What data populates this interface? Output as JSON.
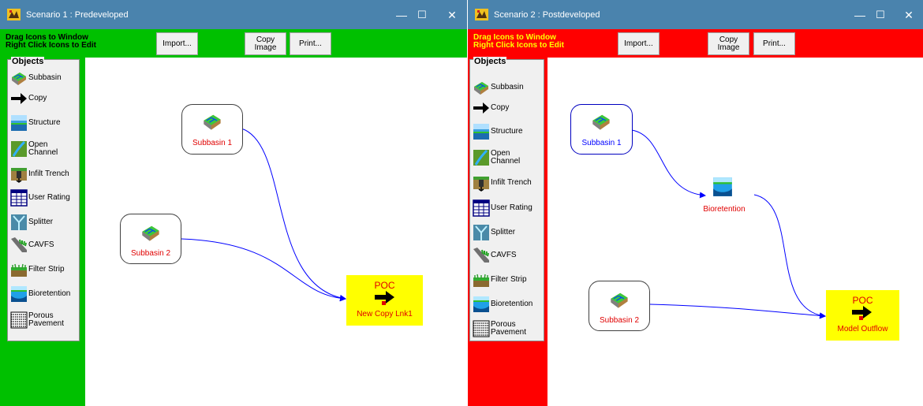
{
  "colors": {
    "titlebar": "#4a83ad",
    "window1_accent": "#00c000",
    "window2_accent": "#ff0000",
    "link_line": "#0000ff",
    "label_red": "#e00000",
    "label_blue": "#0000ff",
    "poc_fill": "#ffff00"
  },
  "window_controls": {
    "minimize": "—",
    "maximize": "☐",
    "close": "✕"
  },
  "windows": [
    {
      "title": "Scenario 1 : Predeveloped",
      "hint_line1": "Drag Icons to Window",
      "hint_line2": "Right Click Icons to Edit",
      "import_label": "Import...",
      "copy_image_label": "Copy\nImage",
      "print_label": "Print...",
      "objects_title": "Objects",
      "objects": [
        {
          "label": "Subbasin",
          "icon": "subbasin-icon"
        },
        {
          "label": "Copy",
          "icon": "copy-arrow-icon"
        },
        {
          "label": "Structure",
          "icon": "structure-icon"
        },
        {
          "label": "Open Channel",
          "icon": "open-channel-icon"
        },
        {
          "label": "Infilt Trench",
          "icon": "infilt-trench-icon"
        },
        {
          "label": "User Rating",
          "icon": "user-rating-icon"
        },
        {
          "label": "Splitter",
          "icon": "splitter-icon"
        },
        {
          "label": "CAVFS",
          "icon": "cavfs-icon"
        },
        {
          "label": "Filter Strip",
          "icon": "filter-strip-icon"
        },
        {
          "label": "Bioretention",
          "icon": "bioretention-icon"
        },
        {
          "label": "Porous\nPavement",
          "icon": "porous-pavement-icon"
        }
      ],
      "nodes": {
        "subbasin_1": "Subbasin 1",
        "subbasin_2": "Subbasin 2",
        "poc_title": "POC",
        "poc_label": "New Copy Lnk1"
      }
    },
    {
      "title": "Scenario 2 : Postdeveloped",
      "hint_line1": "Drag Icons to Window",
      "hint_line2": "Right Click Icons to Edit",
      "import_label": "Import...",
      "copy_image_label": "Copy\nImage",
      "print_label": "Print...",
      "objects_title": "Objects",
      "objects": [
        {
          "label": "Subbasin",
          "icon": "subbasin-icon"
        },
        {
          "label": "Copy",
          "icon": "copy-arrow-icon"
        },
        {
          "label": "Structure",
          "icon": "structure-icon"
        },
        {
          "label": "Open Channel",
          "icon": "open-channel-icon"
        },
        {
          "label": "Infilt Trench",
          "icon": "infilt-trench-icon"
        },
        {
          "label": "User Rating",
          "icon": "user-rating-icon"
        },
        {
          "label": "Splitter",
          "icon": "splitter-icon"
        },
        {
          "label": "CAVFS",
          "icon": "cavfs-icon"
        },
        {
          "label": "Filter Strip",
          "icon": "filter-strip-icon"
        },
        {
          "label": "Bioretention",
          "icon": "bioretention-icon"
        },
        {
          "label": "Porous\nPavement",
          "icon": "porous-pavement-icon"
        }
      ],
      "nodes": {
        "subbasin_1": "Subbasin 1",
        "subbasin_2": "Subbasin 2",
        "bioretention": "Bioretention",
        "poc_title": "POC",
        "poc_label": "Model Outflow"
      }
    }
  ]
}
